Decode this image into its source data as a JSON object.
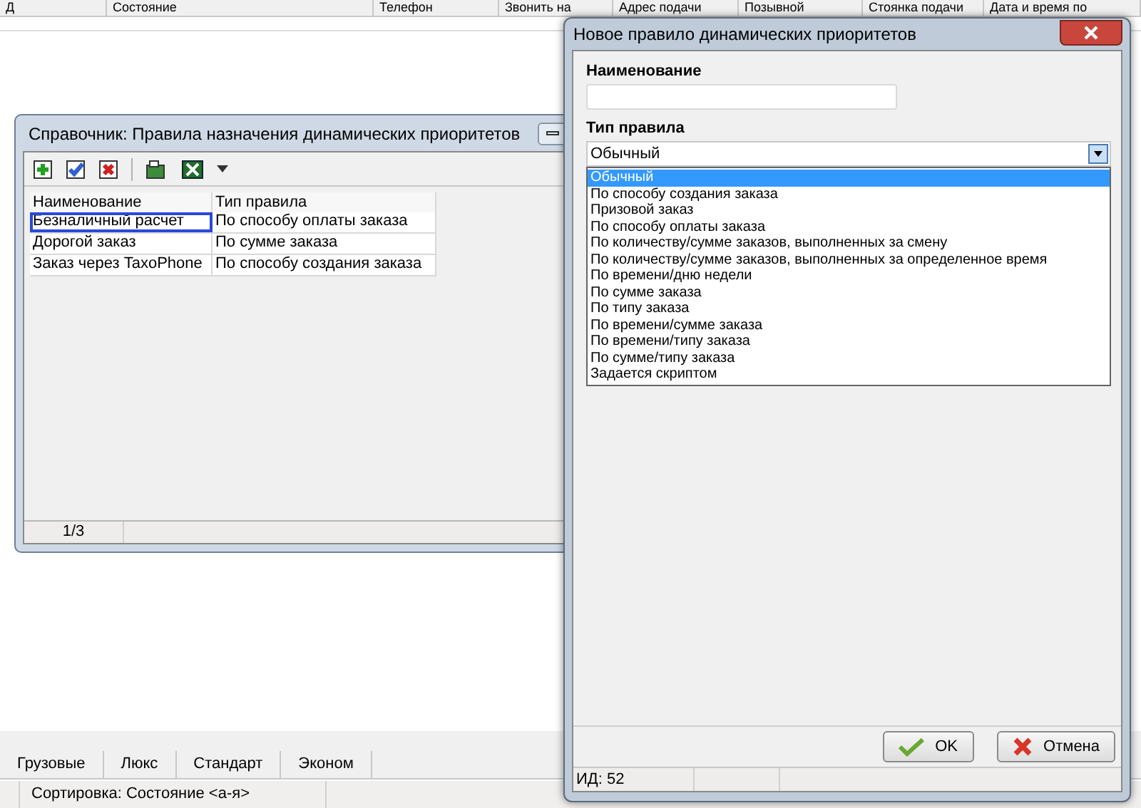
{
  "background_table": {
    "columns": [
      "Д",
      "Состояние",
      "Телефон",
      "Звонить на",
      "Адрес подачи",
      "Позывной",
      "Стоянка подачи",
      "Дата и время по"
    ]
  },
  "tabs": [
    {
      "label": "Грузовые",
      "selected": false
    },
    {
      "label": "Люкс",
      "selected": false
    },
    {
      "label": "Стандарт",
      "selected": false
    },
    {
      "label": "Эконом",
      "selected": false
    }
  ],
  "status_bar": "Сортировка: Состояние <а-я>",
  "reference_window": {
    "title": "Справочник: Правила назначения динамических приоритетов",
    "table": {
      "columns": [
        "Наименование",
        "Тип правила"
      ],
      "rows": [
        {
          "cells": [
            "Безналичный расчет",
            "По способу оплаты заказа"
          ],
          "selected": true
        },
        {
          "cells": [
            "Дорогой заказ",
            "По сумме заказа"
          ],
          "selected": false
        },
        {
          "cells": [
            "Заказ через TaxoPhone",
            "По способу создания заказа"
          ],
          "selected": false
        }
      ]
    },
    "status": "1/3"
  },
  "dialog": {
    "title": "Новое правило динамических приоритетов",
    "name_label": "Наименование",
    "type_label": "Тип правила",
    "type_value": "Обычный",
    "options": [
      {
        "label": "Обычный",
        "selected": true
      },
      {
        "label": "По способу создания заказа",
        "selected": false
      },
      {
        "label": "Призовой заказ",
        "selected": false
      },
      {
        "label": "По способу оплаты заказа",
        "selected": false
      },
      {
        "label": "По количеству/сумме заказов, выполненных за смену",
        "selected": false
      },
      {
        "label": "По количеству/сумме заказов, выполненных за определенное время",
        "selected": false
      },
      {
        "label": "По времени/дню недели",
        "selected": false
      },
      {
        "label": "По сумме заказа",
        "selected": false
      },
      {
        "label": "По типу заказа",
        "selected": false
      },
      {
        "label": "По времени/сумме заказа",
        "selected": false
      },
      {
        "label": "По времени/типу заказа",
        "selected": false
      },
      {
        "label": "По сумме/типу заказа",
        "selected": false
      },
      {
        "label": "Задается скриптом",
        "selected": false
      }
    ],
    "buttons": [
      {
        "label": "OK",
        "kind": "ok"
      },
      {
        "label": "Отмена",
        "kind": "cancel"
      }
    ],
    "status": "ИД: 52"
  }
}
